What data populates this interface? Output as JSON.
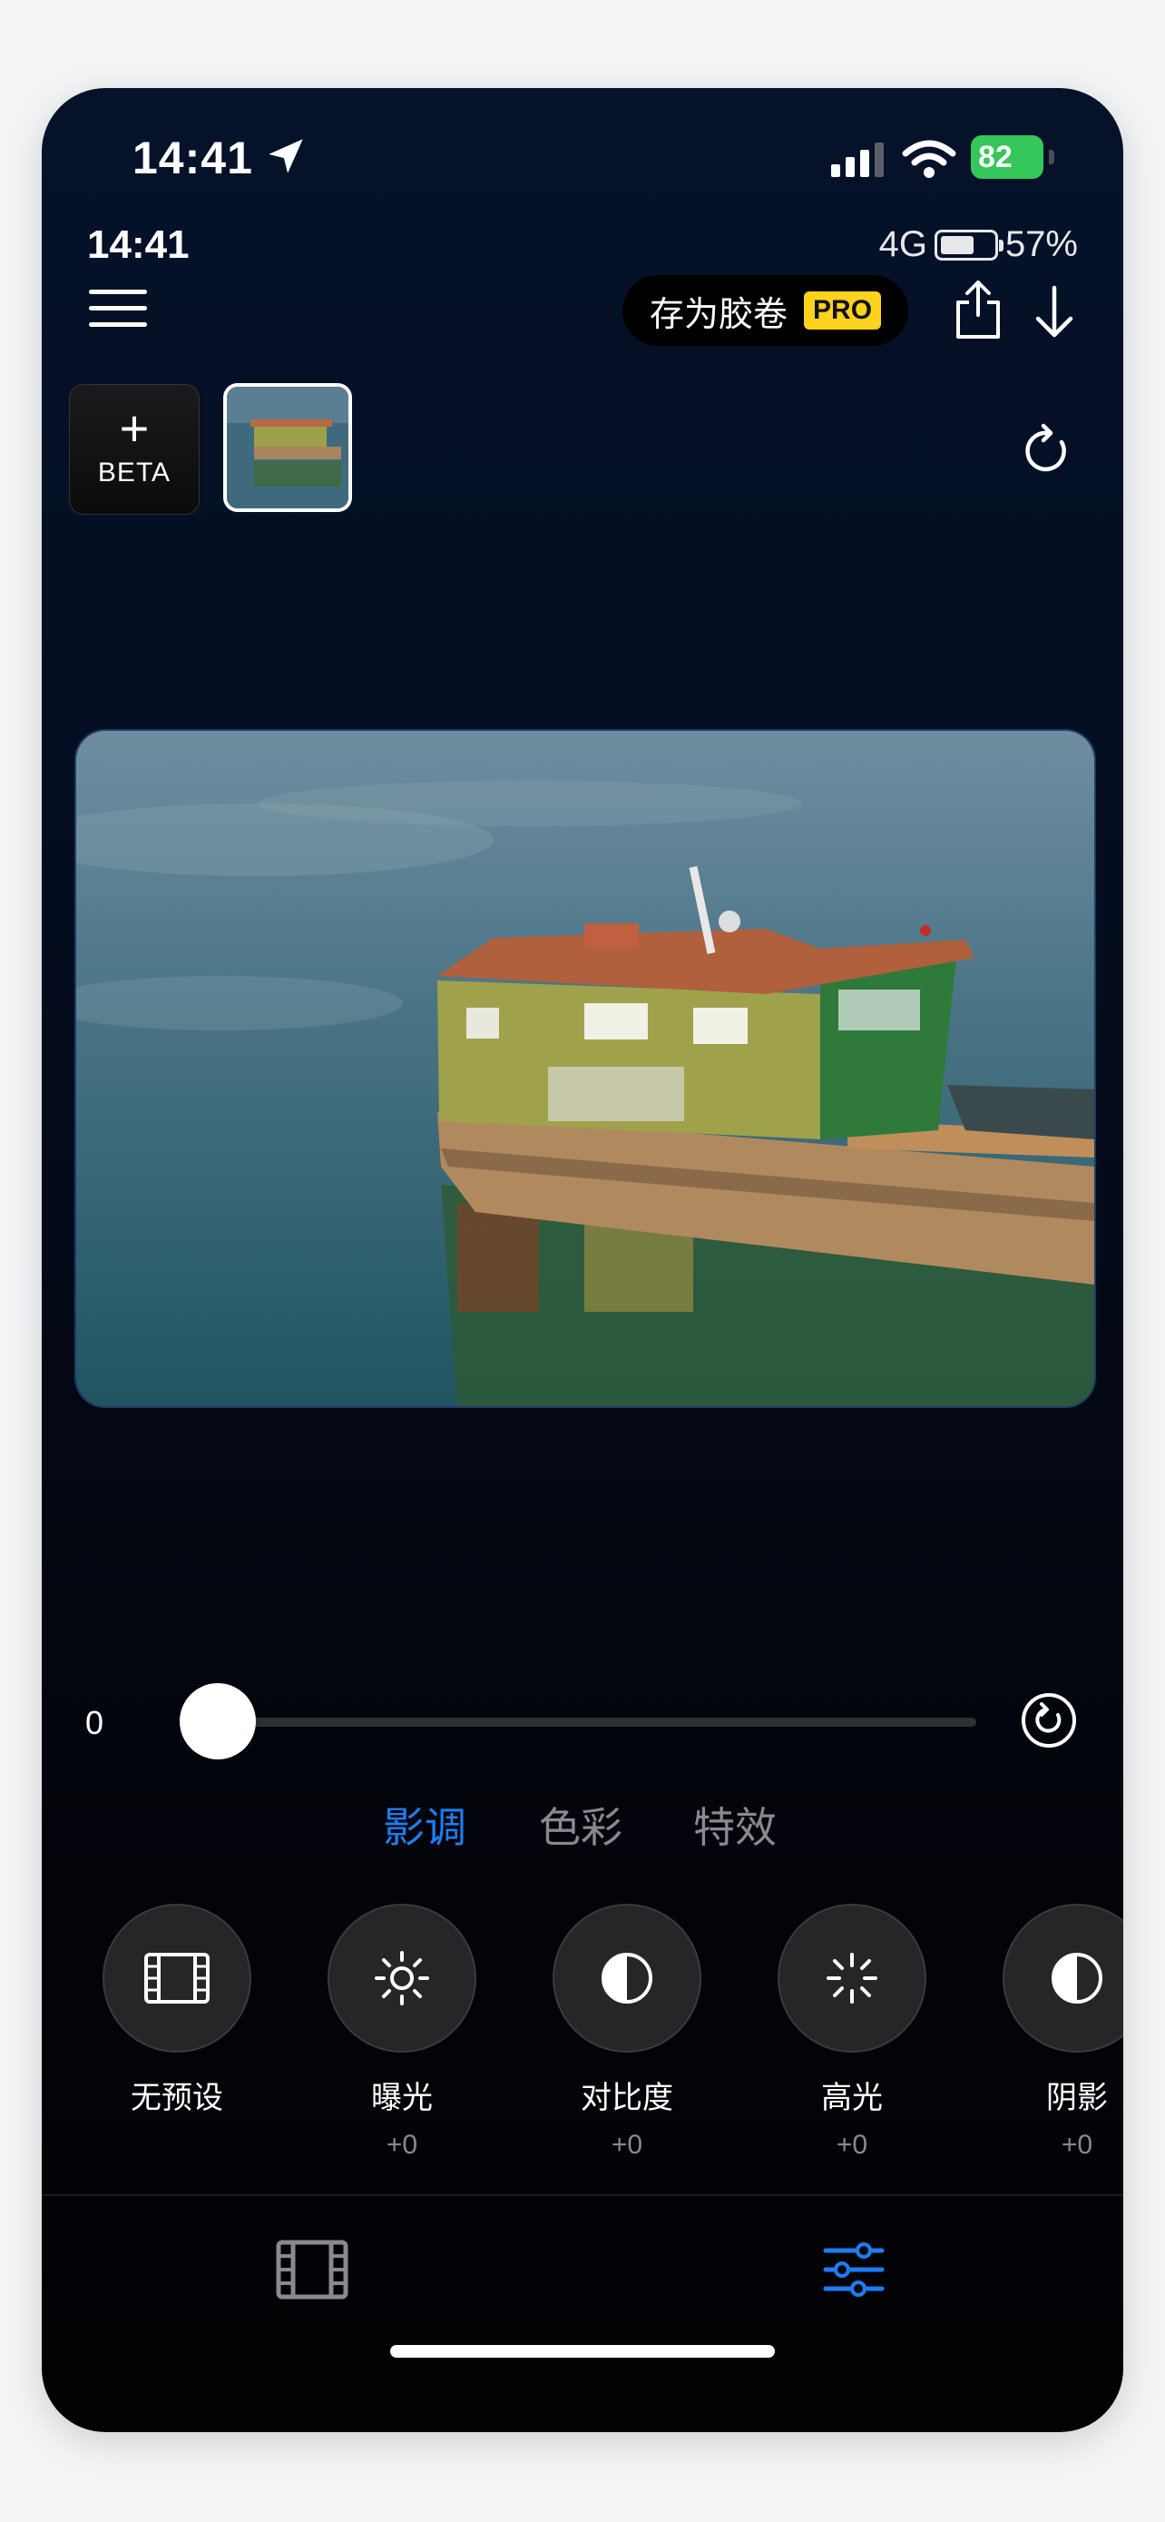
{
  "status_bar": {
    "time": "14:41",
    "battery": "82"
  },
  "top": {
    "time": "14:41",
    "network": "4G",
    "battery_pct": "57%"
  },
  "toolbar": {
    "save_label": "存为胶卷",
    "pro_badge": "PRO"
  },
  "new_button": {
    "plus": "+",
    "label": "BETA"
  },
  "slider": {
    "value": "0",
    "level": 0
  },
  "tabs": [
    {
      "label": "影调",
      "active": true
    },
    {
      "label": "色彩",
      "active": false
    },
    {
      "label": "特效",
      "active": false
    }
  ],
  "tools": [
    {
      "name": "无预设",
      "value": "",
      "icon": "film-icon"
    },
    {
      "name": "曝光",
      "value": "+0",
      "icon": "sun-icon"
    },
    {
      "name": "对比度",
      "value": "+0",
      "icon": "contrast-icon"
    },
    {
      "name": "高光",
      "value": "+0",
      "icon": "highlight-icon"
    },
    {
      "name": "阴影",
      "value": "+0",
      "icon": "shadow-icon"
    }
  ],
  "colors": {
    "accent": "#1e7cf0",
    "pro": "#ffd21e",
    "battery": "#34c759"
  }
}
